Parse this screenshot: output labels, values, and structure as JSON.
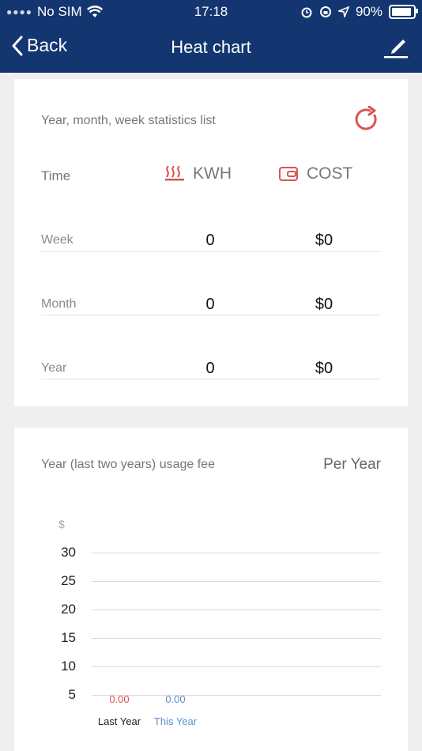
{
  "status": {
    "carrier": "No SIM",
    "time": "17:18",
    "battery": "90%"
  },
  "nav": {
    "back_label": "Back",
    "title": "Heat chart"
  },
  "stats": {
    "title": "Year, month, week statistics list",
    "time_label": "Time",
    "kwh_label": "KWH",
    "cost_label": "COST",
    "rows": [
      {
        "label": "Week",
        "kwh": "0",
        "cost": "$0"
      },
      {
        "label": "Month",
        "kwh": "0",
        "cost": "$0"
      },
      {
        "label": "Year",
        "kwh": "0",
        "cost": "$0"
      }
    ]
  },
  "usage": {
    "title": "Year (last two years) usage fee",
    "period": "Per Year"
  },
  "colors": {
    "nav_bg": "#143670",
    "accent_red": "#d9534f",
    "last_year": "#d9534f",
    "this_year": "#5b8fd0"
  },
  "chart_data": {
    "type": "bar",
    "categories": [
      "Last Year",
      "This Year"
    ],
    "values": [
      0.0,
      0.0
    ],
    "value_labels": [
      "0.00",
      "0.00"
    ],
    "unit_label": "$",
    "yticks": [
      "30",
      "25",
      "20",
      "15",
      "10",
      "5"
    ],
    "ylim": [
      5,
      30
    ],
    "grid": true
  }
}
